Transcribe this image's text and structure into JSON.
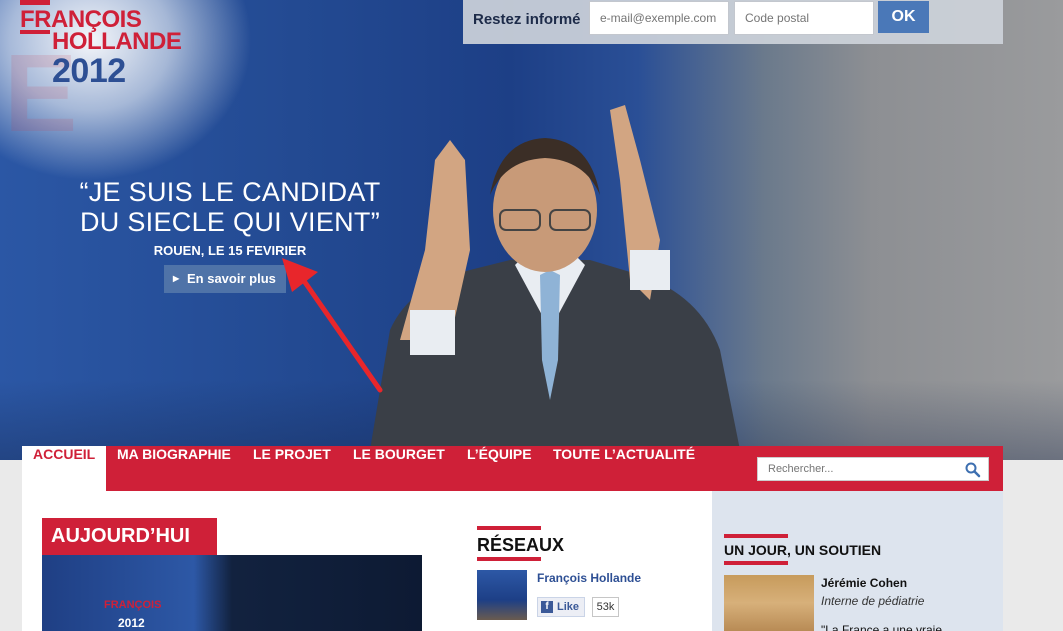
{
  "brand": {
    "line1": "FRANÇOIS",
    "line2": "HOLLANDE",
    "year": "2012",
    "red": "#cf2038",
    "blue": "#2d4f94"
  },
  "newsletter": {
    "label": "Restez informé",
    "email_placeholder": "e-mail@exemple.com",
    "postal_placeholder": "Code postal",
    "submit": "OK"
  },
  "hero": {
    "quote_line1": "“JE SUIS LE CANDIDAT",
    "quote_line2": "DU SIECLE QUI VIENT”",
    "place": "ROUEN, LE 15 FEVIRIER",
    "more_button": "En savoir plus"
  },
  "nav": {
    "items": [
      "ACCUEIL",
      "MA BIOGRAPHIE",
      "LE PROJET",
      "LE BOURGET",
      "L’ÉQUIPE",
      "TOUTE L’ACTUALITÉ"
    ],
    "search_placeholder": "Rechercher..."
  },
  "today": {
    "title": "AUJOURD’HUI",
    "image_text1": "FRANÇOIS",
    "image_text2": "2012"
  },
  "reseaux": {
    "title": "RÉSEAUX",
    "page_name": "François Hollande",
    "like_label": "Like",
    "like_count": "53k"
  },
  "soutien": {
    "title": "UN JOUR, UN SOUTIEN",
    "name": "Jérémie Cohen",
    "role": "Interne de pédiatrie",
    "quote_start": "\"La France a une vraie"
  }
}
